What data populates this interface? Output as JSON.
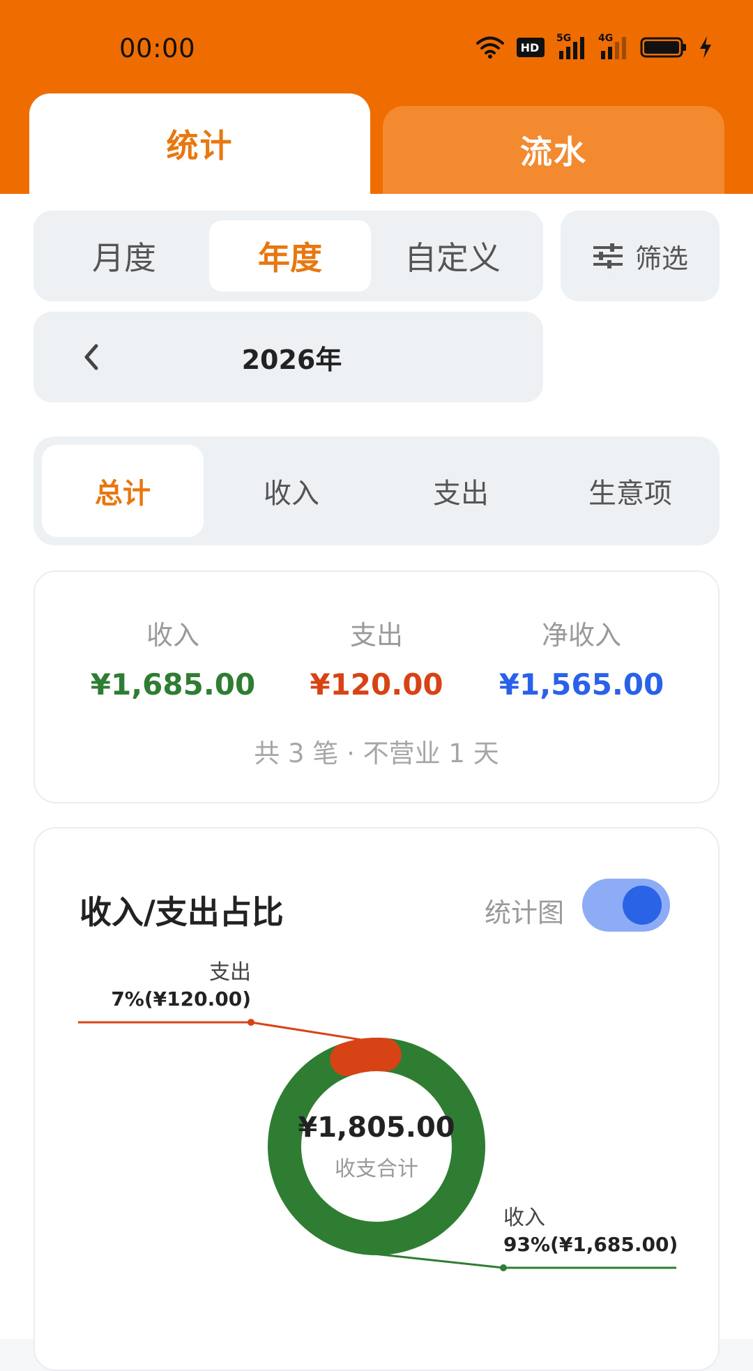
{
  "status_bar": {
    "time": "00:00",
    "network_1": "5G",
    "network_2": "4G"
  },
  "top_tabs": {
    "statistics": "统计",
    "flow": "流水"
  },
  "period_mode": {
    "monthly": "月度",
    "yearly": "年度",
    "custom": "自定义",
    "selected": "年度"
  },
  "filter": {
    "label": "筛选"
  },
  "period": {
    "label": "2026年"
  },
  "sub_tabs": {
    "total": "总计",
    "income": "收入",
    "expense": "支出",
    "business": "生意项",
    "selected": "总计"
  },
  "summary": {
    "income_label": "收入",
    "income_value": "¥1,685.00",
    "expense_label": "支出",
    "expense_value": "¥120.00",
    "net_label": "净收入",
    "net_value": "¥1,565.00",
    "footer": "共 3 笔 · 不营业 1 天"
  },
  "ratio_card": {
    "title": "收入/支出占比",
    "toggle_label": "统计图",
    "toggle_on": true
  },
  "colors": {
    "brand": "#ef6c00",
    "income": "#2e7d32",
    "expense": "#d84315",
    "net": "#2962e8"
  },
  "chart_data": {
    "type": "pie",
    "donut": true,
    "center_value": "¥1,805.00",
    "center_label": "收支合计",
    "slices": [
      {
        "name": "收入",
        "value": 1685.0,
        "percent_label": "93%(¥1,685.00)",
        "color": "#2e7d32"
      },
      {
        "name": "支出",
        "value": 120.0,
        "percent_label": "7%(¥120.00)",
        "color": "#d84315"
      }
    ]
  }
}
